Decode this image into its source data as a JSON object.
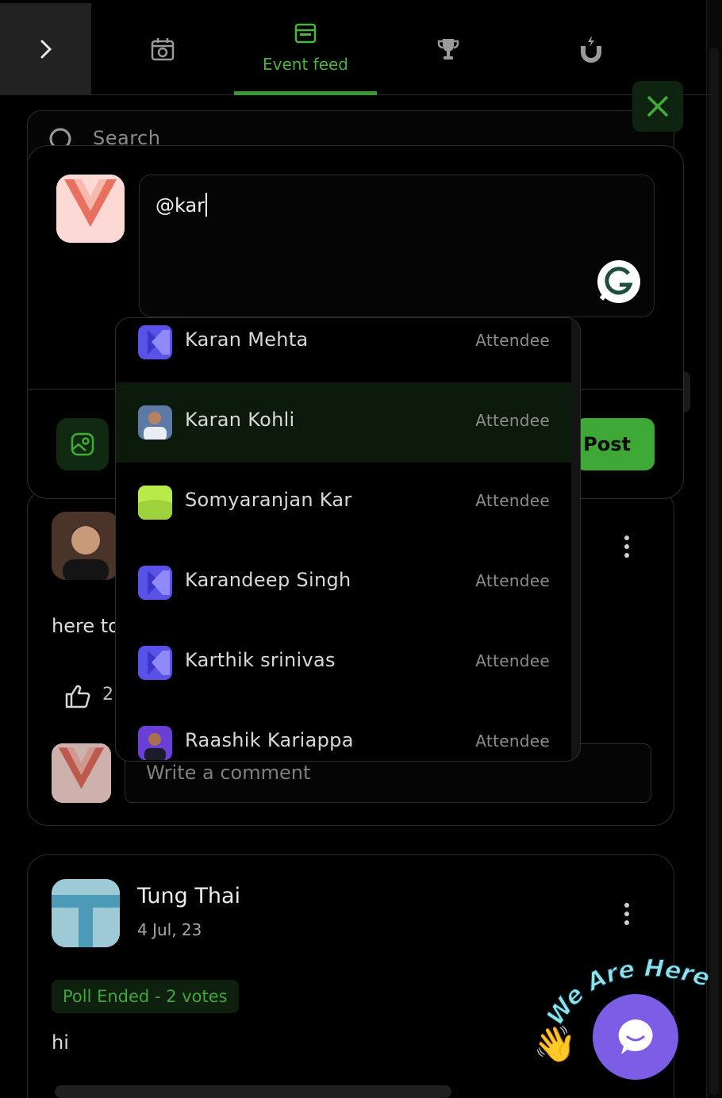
{
  "nav": {
    "collapse_icon": "chevron-right-icon",
    "tabs": [
      {
        "icon": "camera-calendar-icon",
        "label": ""
      },
      {
        "icon": "feed-browser-icon",
        "label": "Event feed",
        "active": true
      },
      {
        "icon": "trophy-icon",
        "label": ""
      },
      {
        "icon": "magnet-icon",
        "label": ""
      }
    ]
  },
  "search": {
    "placeholder": "Search"
  },
  "composer": {
    "text": "@kar",
    "post_label": "Post",
    "media_icon": "image-icon",
    "grammarly_icon": "grammarly-icon"
  },
  "mentions": [
    {
      "name": "Karan Mehta",
      "role": "Attendee",
      "avatar": "k-logo"
    },
    {
      "name": "Karan Kohli",
      "role": "Attendee",
      "avatar": "photo",
      "active": true
    },
    {
      "name": "Somyaranjan Kar",
      "role": "Attendee",
      "avatar": "lime-logo"
    },
    {
      "name": "Karandeep Singh",
      "role": "Attendee",
      "avatar": "k-logo"
    },
    {
      "name": "Karthik srinivas",
      "role": "Attendee",
      "avatar": "k-logo"
    },
    {
      "name": "Raashik Kariappa",
      "role": "Attendee",
      "avatar": "photo"
    }
  ],
  "post1": {
    "text": "here to",
    "like_count": "2",
    "comment_placeholder": "Write a comment"
  },
  "post2": {
    "author": "Tung Thai",
    "date": "4 Jul, 23",
    "poll_status": "Poll Ended - 2 votes",
    "text": "hi"
  },
  "chat_widget": {
    "banner": "We Are Here!"
  },
  "colors": {
    "accent": "#3ea836",
    "chat": "#7d5ce6"
  }
}
